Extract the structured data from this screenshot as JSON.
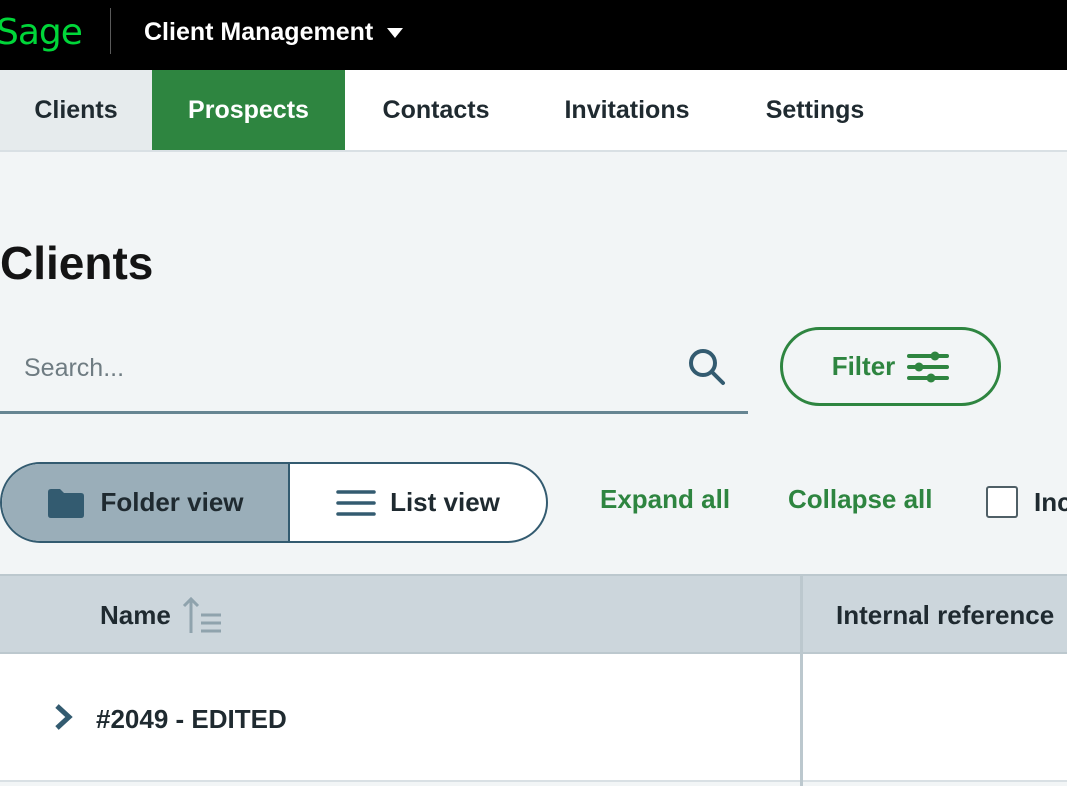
{
  "header": {
    "logo_text": "Sage",
    "product_name": "Client Management",
    "product_icon": "caret-down-icon"
  },
  "nav": {
    "tabs": [
      {
        "label": "Clients"
      },
      {
        "label": "Prospects",
        "active": true
      },
      {
        "label": "Contacts"
      },
      {
        "label": "Invitations"
      },
      {
        "label": "Settings"
      }
    ]
  },
  "page": {
    "title": "Clients"
  },
  "search": {
    "placeholder": "Search...",
    "value": "",
    "icon": "search-icon"
  },
  "filter": {
    "label": "Filter",
    "icon": "sliders-icon"
  },
  "view_toggle": {
    "folder_label": "Folder view",
    "list_label": "List view",
    "selected": "Folder view"
  },
  "actions": {
    "expand_all": "Expand all",
    "collapse_all": "Collapse all",
    "include_label": "Inc"
  },
  "table": {
    "columns": [
      "Name",
      "Internal reference"
    ],
    "sort_column": "Name",
    "rows": [
      {
        "name": "#2049 - EDITED",
        "internal_reference": ""
      }
    ]
  },
  "colors": {
    "brand_green": "#00d639",
    "accent_green": "#2e8540",
    "topbar": "#000000",
    "toggle_selected": "#9aaeb9"
  }
}
